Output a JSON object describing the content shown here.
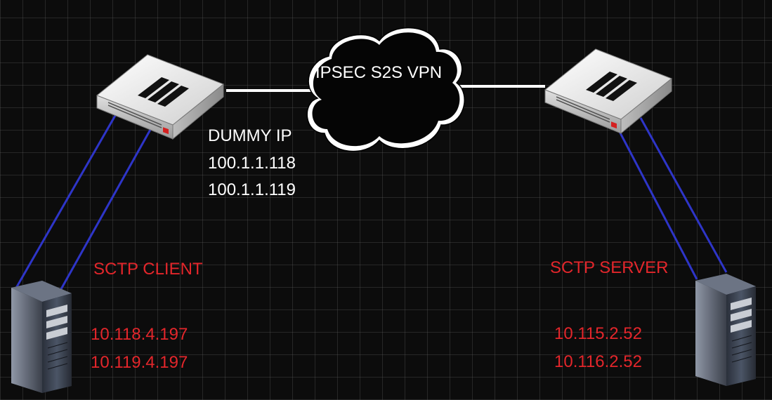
{
  "cloud": {
    "label": "IPSEC S2S VPN"
  },
  "dummy_ip": {
    "title": "DUMMY IP",
    "ips": [
      "100.1.1.118",
      "100.1.1.119"
    ]
  },
  "client": {
    "label": "SCTP CLIENT",
    "ips": [
      "10.118.4.197",
      "10.119.4.197"
    ]
  },
  "server": {
    "label": "SCTP SERVER",
    "ips": [
      "10.115.2.52",
      "10.116.2.52"
    ]
  },
  "colors": {
    "tunnel_link": "#ffffff",
    "lan_link": "#2e35c8",
    "client_server_text": "#e3262b",
    "background": "#0c0c0c"
  },
  "icons": {
    "left_device": "firewall-icon",
    "right_device": "firewall-icon",
    "left_host": "server-tower-icon",
    "right_host": "server-tower-icon",
    "vpn": "cloud-icon"
  }
}
